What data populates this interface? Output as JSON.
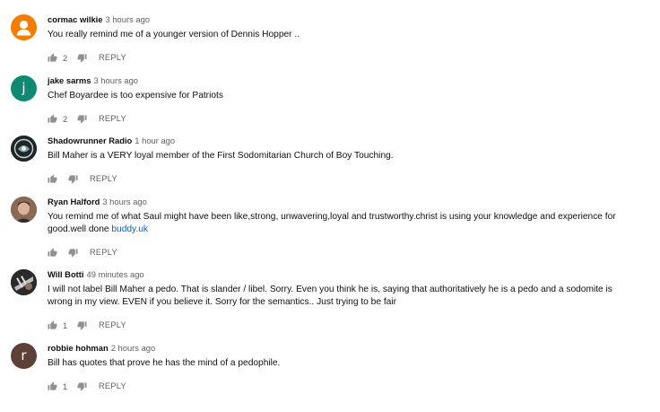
{
  "comments": [
    {
      "author": "cormac wilkie",
      "time": "3 hours ago",
      "text": "You really remind me of a younger version of Dennis Hopper ..",
      "likes": "2",
      "reply_label": "REPLY",
      "avatar": {
        "kind": "default-person",
        "color": "#f57c00"
      }
    },
    {
      "author": "jake sarms",
      "time": "3 hours ago",
      "text": "Chef Boyardee is too expensive for Patriots",
      "likes": "2",
      "reply_label": "REPLY",
      "avatar": {
        "kind": "letter",
        "letter": "j",
        "color": "#0f8a72"
      }
    },
    {
      "author": "Shadowrunner Radio",
      "time": "1 hour ago",
      "text": "Bill Maher is a VERY loyal member of the First Sodomitarian Church of Boy Touching.",
      "likes": "",
      "reply_label": "REPLY",
      "avatar": {
        "kind": "photo",
        "color": "#2f3a3a"
      }
    },
    {
      "author": "Ryan Halford",
      "time": "3 hours ago",
      "text": "You remind me of what Saul might have been like,strong, unwavering,loyal and trustworthy.christ is using your knowledge and experience for good.well done",
      "link_text": "buddy.uk",
      "likes": "",
      "reply_label": "REPLY",
      "avatar": {
        "kind": "photo",
        "color": "#6b4a3a"
      }
    },
    {
      "author": "Will Botti",
      "time": "49 minutes ago",
      "text": "I will not label Bill Maher a pedo. That is slander / libel. Sorry.  Even you think he is, saying that authoritatively he is a pedo and a sodomite is wrong in my view.  EVEN if you believe it.  Sorry for the semantics.. Just trying to be fair",
      "likes": "1",
      "reply_label": "REPLY",
      "avatar": {
        "kind": "photo",
        "color": "#3a3a3a"
      }
    },
    {
      "author": "robbie hohman",
      "time": "2 hours ago",
      "text": "Bill has quotes that prove he has the mind of a pedophile.",
      "likes": "1",
      "reply_label": "REPLY",
      "avatar": {
        "kind": "letter",
        "letter": "r",
        "color": "#5d4037"
      }
    }
  ]
}
